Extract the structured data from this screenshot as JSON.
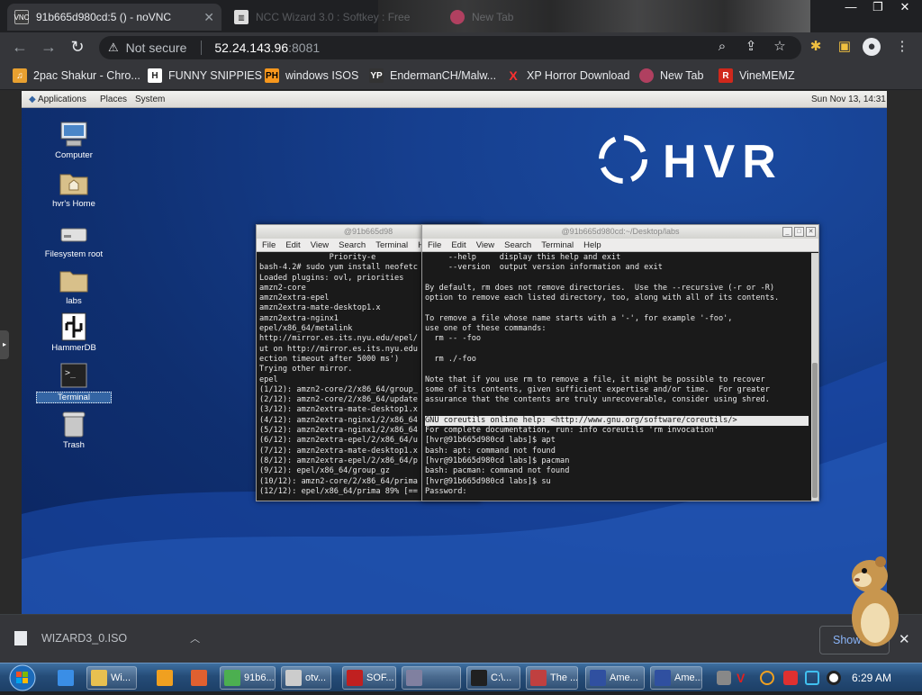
{
  "browser": {
    "tabs": [
      {
        "title": "91b665d980cd:5 () - noVNC",
        "icon": "vnc-icon",
        "active": true
      },
      {
        "title": "NCC Wizard 3.0 : Softkey : Free",
        "icon": "archive-icon",
        "active": false
      },
      {
        "title": "New Tab",
        "icon": "newtab-icon",
        "active": false
      }
    ],
    "window_controls": {
      "minimize": "—",
      "restore": "❐",
      "close": "✕"
    },
    "address": {
      "security_label": "Not secure",
      "host": "52.24.143.96",
      "port": ":8081"
    },
    "bookmarks": [
      {
        "label": "2pac Shakur - Chro...",
        "icon": "music-icon",
        "color": "#e8a030"
      },
      {
        "label": "FUNNY SNIPPIES",
        "icon": "h-logo-icon",
        "color": "#222222"
      },
      {
        "label": "windows ISOS",
        "icon": "ph-logo-icon",
        "color": "#f7971d"
      },
      {
        "label": "EndermanCH/Malw...",
        "icon": "yp-logo-icon",
        "color": "#333333"
      },
      {
        "label": "XP Horror Download",
        "icon": "x-logo-icon",
        "color": "#ff3030"
      },
      {
        "label": "New Tab",
        "icon": "newtab-icon",
        "color": "#b04060"
      },
      {
        "label": "VineMEMZ",
        "icon": "r-logo-icon",
        "color": "#d0281c"
      }
    ]
  },
  "desktop": {
    "panel": {
      "menus": [
        "Applications",
        "Places",
        "System"
      ],
      "datetime": "Sun Nov 13, 14:31"
    },
    "icons": [
      {
        "label": "Computer",
        "icon": "computer-icon",
        "selected": false
      },
      {
        "label": "hvr's Home",
        "icon": "home-folder-icon",
        "selected": false
      },
      {
        "label": "Filesystem root",
        "icon": "drive-icon",
        "selected": false
      },
      {
        "label": "labs",
        "icon": "folder-icon",
        "selected": false
      },
      {
        "label": "HammerDB",
        "icon": "hammerdb-icon",
        "selected": false
      },
      {
        "label": "Terminal",
        "icon": "terminal-icon",
        "selected": true
      },
      {
        "label": "Trash",
        "icon": "trash-icon",
        "selected": false
      }
    ],
    "logo_text": "HVR"
  },
  "terminal_back": {
    "title": "@91b665d98",
    "menu": [
      "File",
      "Edit",
      "View",
      "Search",
      "Terminal",
      "H"
    ],
    "lines": [
      "               Priority-e",
      "bash-4.2# sudo yum install neofetc",
      "Loaded plugins: ovl, priorities",
      "amzn2-core",
      "amzn2extra-epel",
      "amzn2extra-mate-desktop1.x",
      "amzn2extra-nginx1",
      "epel/x86_64/metalink",
      "http://mirror.es.its.nyu.edu/epel/",
      "ut on http://mirror.es.its.nyu.edu",
      "ection timeout after 5000 ms')",
      "Trying other mirror.",
      "epel",
      "(1/12): amzn2-core/2/x86_64/group_",
      "(2/12): amzn2-core/2/x86_64/update",
      "(3/12): amzn2extra-mate-desktop1.x",
      "(4/12): amzn2extra-nginx1/2/x86_64",
      "(5/12): amzn2extra-nginx1/2/x86_64",
      "(6/12): amzn2extra-epel/2/x86_64/u",
      "(7/12): amzn2extra-mate-desktop1.x",
      "(8/12): amzn2extra-epel/2/x86_64/p",
      "(9/12): epel/x86_64/group_gz",
      "(10/12): amzn2-core/2/x86_64/prima",
      "(12/12): epel/x86_64/prima 89% [=="
    ]
  },
  "terminal_front": {
    "title": "@91b665d980cd:~/Desktop/labs",
    "menu": [
      "File",
      "Edit",
      "View",
      "Search",
      "Terminal",
      "Help"
    ],
    "lines": [
      "     --help     display this help and exit",
      "     --version  output version information and exit",
      "",
      "By default, rm does not remove directories.  Use the --recursive (-r or -R)",
      "option to remove each listed directory, too, along with all of its contents.",
      "",
      "To remove a file whose name starts with a '-', for example '-foo',",
      "use one of these commands:",
      "  rm -- -foo",
      "",
      "  rm ./-foo",
      "",
      "Note that if you use rm to remove a file, it might be possible to recover",
      "some of its contents, given sufficient expertise and/or time.  For greater",
      "assurance that the contents are truly unrecoverable, consider using shred.",
      "",
      "GNU coreutils online help: <http://www.gnu.org/software/coreutils/>",
      "For complete documentation, run: info coreutils 'rm invocation'",
      "[hvr@91b665d980cd labs]$ apt",
      "bash: apt: command not found",
      "[hvr@91b665d980cd labs]$ pacman",
      "bash: pacman: command not found",
      "[hvr@91b665d980cd labs]$ su",
      "Password:"
    ]
  },
  "downloads": {
    "filename": "WIZARD3_0.ISO",
    "show_all": "Show all"
  },
  "taskbar": {
    "items": [
      {
        "label": "",
        "icon": "ie-icon",
        "color": "#3a8ee6",
        "window": false
      },
      {
        "label": "Wi...",
        "icon": "explorer-icon",
        "color": "#e8c050",
        "window": true
      },
      {
        "label": "",
        "icon": "media-icon",
        "color": "#f0a020",
        "window": false
      },
      {
        "label": "",
        "icon": "paint-icon",
        "color": "#e06030",
        "window": false
      },
      {
        "label": "91b6...",
        "icon": "chrome-icon",
        "color": "#4caf50",
        "window": true
      },
      {
        "label": "otv...",
        "icon": "window-icon",
        "color": "#cccccc",
        "window": true
      },
      {
        "label": "SOF...",
        "icon": "softkey-icon",
        "color": "#c02020",
        "window": true
      },
      {
        "label": "",
        "icon": "printer-icon",
        "color": "#8080a0",
        "window": true
      },
      {
        "label": "C:\\...",
        "icon": "cmd-icon",
        "color": "#202020",
        "window": true
      },
      {
        "label": "The ...",
        "icon": "app-icon",
        "color": "#c04040",
        "window": true
      },
      {
        "label": "Ame...",
        "icon": "triangle-icon",
        "color": "#3050a0",
        "window": true
      },
      {
        "label": "Ame...",
        "icon": "triangle-icon",
        "color": "#3050a0",
        "window": true
      }
    ],
    "clock": "6:29 AM"
  }
}
